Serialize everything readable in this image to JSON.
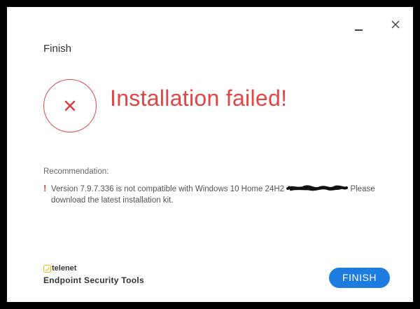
{
  "window": {
    "title": "Finish"
  },
  "status": {
    "headline": "Installation failed!",
    "icon": "error-x-icon",
    "color": "#e04646"
  },
  "recommendation": {
    "label": "Recommendation:",
    "message_before": "Version 7.9.7.336 is not compatible with Windows 10 Home 24H2",
    "message_after": "Please download the latest installation kit."
  },
  "brand": {
    "name": "telenet",
    "product": "Endpoint Security Tools",
    "accent_color": "#f2b400"
  },
  "buttons": {
    "finish_label": "FINISH",
    "finish_color": "#1e7ce0"
  }
}
